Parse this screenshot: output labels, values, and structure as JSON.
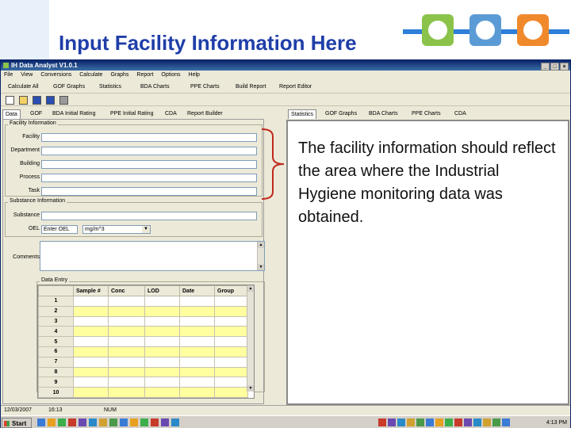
{
  "slide": {
    "title": "Input Facility Information Here",
    "description": "The facility information should reflect the area where the Industrial Hygiene monitoring data was obtained."
  },
  "colors": {
    "title": "#1f3ea8",
    "accent_green": "#8bc34a",
    "accent_blue": "#5b9bd5",
    "accent_orange": "#f0892c",
    "cell_yellow": "#ffffa0"
  },
  "window": {
    "title": "IH Data Analyst V1.0.1",
    "menu": [
      "File",
      "View",
      "Conversions",
      "Calculate",
      "Graphs",
      "Report",
      "Options",
      "Help"
    ],
    "toolbar": [
      "Calculate All",
      "GOF Graphs",
      "Statistics",
      "BDA Charts",
      "PPE Charts",
      "Build Report",
      "Report Editor"
    ],
    "toolbar_icons": [
      "new-file-icon",
      "open-folder-icon",
      "save-icon",
      "save-as-icon",
      "print-icon"
    ]
  },
  "tabs_left": [
    "Data",
    "GOF",
    "BDA Initial Rating",
    "PPE Initial Rating",
    "CDA",
    "Report Builder"
  ],
  "tabs_right": [
    "Statistics",
    "GOF Graphs",
    "BDA Charts",
    "PPE Charts",
    "CDA"
  ],
  "facility": {
    "group_label": "Facility Information",
    "fields": [
      "Facility",
      "Department",
      "Building",
      "Process",
      "Task"
    ]
  },
  "substance": {
    "group_label": "Substance Information",
    "substance_label": "Substance",
    "oel_label": "OEL",
    "oel_value": "Enter OEL",
    "unit_value": "mg/m^3"
  },
  "comments_label": "Comments",
  "data_entry": {
    "group_label": "Data Entry",
    "columns": [
      "",
      "Sample #",
      "Conc",
      "LOD",
      "Date",
      "Group"
    ],
    "row_numbers": [
      "1",
      "2",
      "3",
      "4",
      "5",
      "6",
      "7",
      "8",
      "9",
      "10"
    ]
  },
  "status": {
    "date": "12/03/2007",
    "time": "16:13",
    "mode": "NUM"
  },
  "taskbar": {
    "start": "Start",
    "clock": "4:13 PM"
  }
}
